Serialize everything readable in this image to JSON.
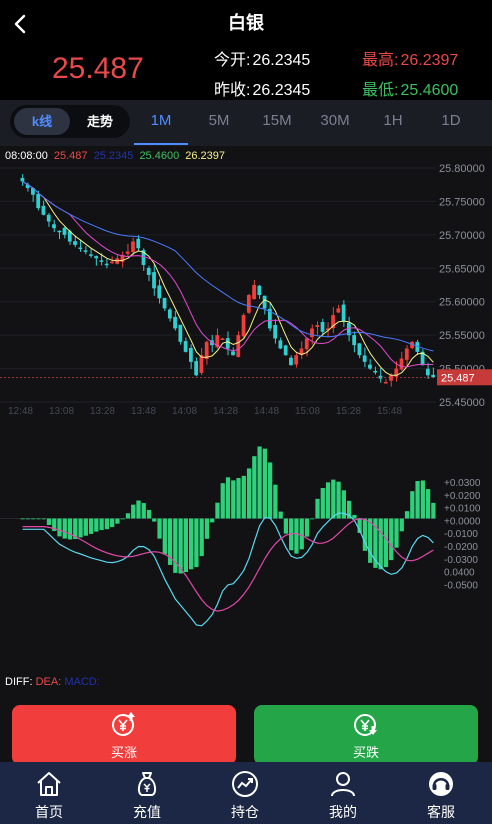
{
  "header": {
    "title": "白银",
    "price": "25.487",
    "stats": {
      "open_label": "今开:",
      "open_value": "26.2345",
      "high_label": "最高:",
      "high_value": "26.2397",
      "prev_close_label": "昨收:",
      "prev_close_value": "26.2345",
      "low_label": "最低:",
      "low_value": "25.4600"
    }
  },
  "tabs": {
    "segments": [
      "k线",
      "走势"
    ],
    "periods": [
      "1M",
      "5M",
      "15M",
      "30M",
      "1H",
      "1D"
    ],
    "active_period": "1M"
  },
  "chart": {
    "info": {
      "time": "08:08:00",
      "price": "25.487",
      "v2": "25.2345",
      "v3": "25.4600",
      "v4": "26.2397"
    },
    "current_price_tag": "25.487",
    "macd_legend": {
      "diff": "DIFF:",
      "dea": "DEA:",
      "macd": "MACD:"
    }
  },
  "chart_data": [
    {
      "type": "candlestick",
      "y_ticks": [
        "25.80000",
        "25.75000",
        "25.70000",
        "25.65000",
        "25.60000",
        "25.55000",
        "25.50000",
        "25.45000"
      ],
      "x_ticks": [
        "12:48",
        "13:08",
        "13:28",
        "13:48",
        "14:08",
        "14:28",
        "14:48",
        "15:08",
        "15:28",
        "15:48"
      ],
      "ylim": [
        25.45,
        25.8
      ],
      "close_series": [
        25.78,
        25.77,
        25.76,
        25.74,
        25.73,
        25.72,
        25.71,
        25.705,
        25.7,
        25.69,
        25.685,
        25.68,
        25.675,
        25.67,
        25.665,
        25.66,
        25.655,
        25.66,
        25.665,
        25.67,
        25.675,
        25.69,
        25.68,
        25.655,
        25.64,
        25.62,
        25.605,
        25.59,
        25.575,
        25.56,
        25.54,
        25.525,
        25.51,
        25.49,
        25.52,
        25.54,
        25.535,
        25.55,
        25.545,
        25.53,
        25.52,
        25.55,
        25.58,
        25.61,
        25.625,
        25.61,
        25.59,
        25.56,
        25.545,
        25.53,
        25.52,
        25.505,
        25.52,
        25.53,
        25.545,
        25.56,
        25.565,
        25.555,
        25.56,
        25.58,
        25.59,
        25.57,
        25.55,
        25.535,
        25.52,
        25.51,
        25.5,
        25.495,
        25.485,
        25.48,
        25.49,
        25.5,
        25.515,
        25.53,
        25.54,
        25.525,
        25.505,
        25.49,
        25.487
      ],
      "colors": {
        "up": "#f23d3d",
        "down": "#2ed1d1",
        "ma5": "#f5f28a",
        "ma10": "#e04ad0",
        "ma30": "#4a7bff"
      }
    },
    {
      "type": "bar",
      "title": "MACD",
      "y_ticks": [
        "+0.0300",
        "+0.0200",
        "+0.0100",
        "+0.0000",
        "-0.0100",
        "-0.0200",
        "-0.0300",
        "0.0400",
        "-0.0500"
      ],
      "ylim": [
        -0.05,
        0.03
      ],
      "colors": {
        "up": "#2ed17a",
        "down": "#2ed17a",
        "diff": "#5ad8f0",
        "dea": "#e04aa8"
      }
    }
  ],
  "actions": {
    "buy_label": "买涨",
    "sell_label": "买跌"
  },
  "bottom_nav": [
    {
      "label": "首页",
      "icon": "home-icon"
    },
    {
      "label": "充值",
      "icon": "money-bag-icon"
    },
    {
      "label": "持仓",
      "icon": "trend-icon"
    },
    {
      "label": "我的",
      "icon": "user-icon"
    },
    {
      "label": "客服",
      "icon": "headset-icon"
    }
  ]
}
